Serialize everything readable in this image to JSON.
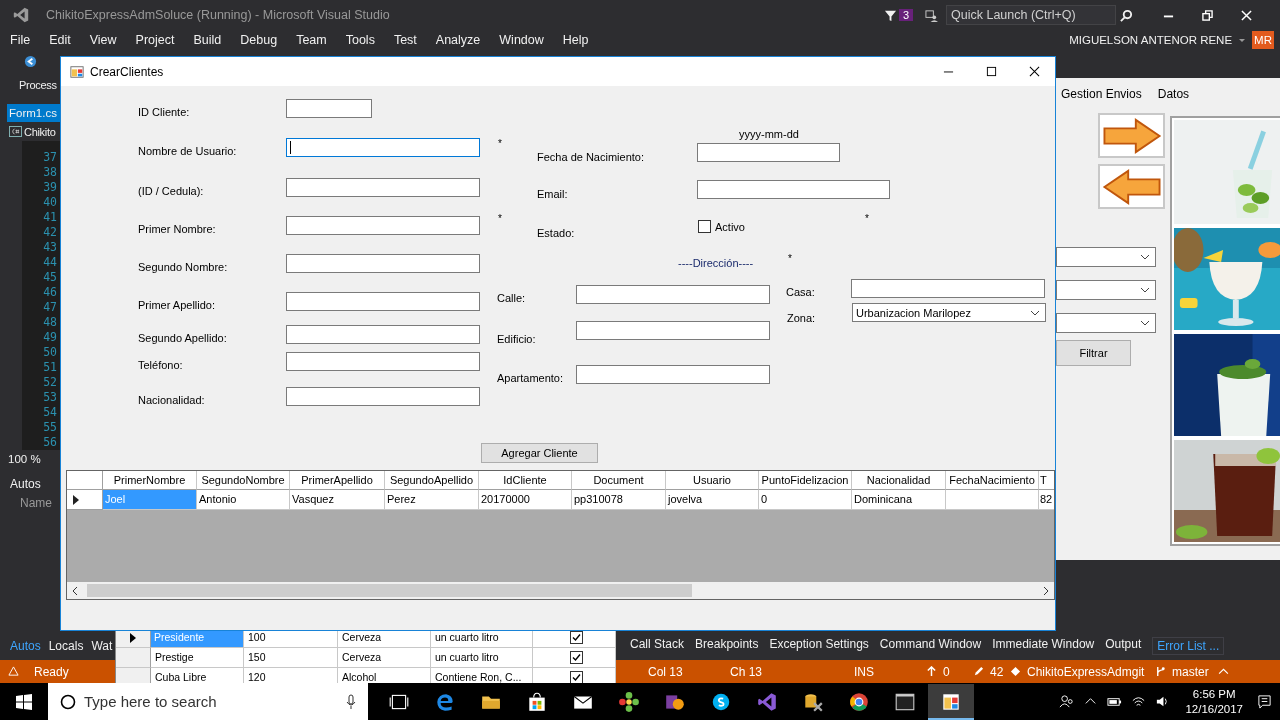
{
  "ide": {
    "title": "ChikitoExpressAdmSoluce (Running) - Microsoft Visual Studio",
    "notification_count": "3",
    "quick_launch": {
      "placeholder": "Quick Launch (Ctrl+Q)"
    },
    "menu": [
      "File",
      "Edit",
      "View",
      "Project",
      "Build",
      "Debug",
      "Team",
      "Tools",
      "Test",
      "Analyze",
      "Window",
      "Help"
    ],
    "user": "MIGUELSON ANTENOR RENE",
    "avatar": "MR",
    "left_panel": {
      "process_label": "Process",
      "tab": {
        "label": "Form1.cs",
        "selected": true
      },
      "file": "Chikito",
      "line_numbers": [
        "37",
        "38",
        "39",
        "40",
        "41",
        "42",
        "43",
        "44",
        "45",
        "46",
        "47",
        "48",
        "49",
        "50",
        "51",
        "52",
        "53",
        "54",
        "55",
        "56"
      ],
      "zoom": "100 %",
      "autos_title": "Autos",
      "autos_column": "Name",
      "bottom_tabs": [
        {
          "label": "Autos",
          "selected": true
        },
        {
          "label": "Locals",
          "selected": false
        },
        {
          "label": "Wat",
          "selected": false
        }
      ]
    },
    "tool_tabs": [
      {
        "label": "Call Stack",
        "selected": false
      },
      {
        "label": "Breakpoints",
        "selected": false
      },
      {
        "label": "Exception Settings",
        "selected": false
      },
      {
        "label": "Command Window",
        "selected": false
      },
      {
        "label": "Immediate Window",
        "selected": false
      },
      {
        "label": "Output",
        "selected": false
      },
      {
        "label": "Error List ...",
        "selected": true
      }
    ],
    "status_bar": {
      "state": "Ready",
      "col": "Col 13",
      "ch": "Ch 13",
      "mode": "INS",
      "pushes": "0",
      "changes": "42",
      "repo": "ChikitoExpressAdmgit",
      "branch": "master"
    }
  },
  "background_app": {
    "menu": [
      "Gestion Envios",
      "Datos"
    ],
    "filter_button": "Filtrar",
    "pictures": [
      {
        "kind": "picture"
      },
      {
        "kind": "picture"
      },
      {
        "kind": "picture"
      },
      {
        "kind": "picture"
      }
    ]
  },
  "product_grid": {
    "rows": [
      {
        "name": "Presidente",
        "price": "100",
        "type": "Cerveza",
        "description": "un cuarto litro",
        "checked": true,
        "selected": true
      },
      {
        "name": "Prestige",
        "price": "150",
        "type": "Cerveza",
        "description": "un cuarto litro",
        "checked": true,
        "selected": false
      },
      {
        "name": "Cuba Libre",
        "price": "120",
        "type": "Alcohol",
        "description": "Contiene Ron, C...",
        "checked": true,
        "selected": false
      }
    ]
  },
  "dialog": {
    "title": "CrearClientes",
    "personal_fields": [
      {
        "label": "ID Cliente:",
        "focused": false
      },
      {
        "label": "Nombre de Usuario:",
        "focused": true
      },
      {
        "label": "(ID / Cedula):",
        "focused": false
      },
      {
        "label": "Primer Nombre:",
        "focused": false
      },
      {
        "label": "Segundo Nombre:",
        "focused": false
      },
      {
        "label": "Primer Apellido:",
        "focused": false
      },
      {
        "label": "Segundo Apellido:",
        "focused": false
      },
      {
        "label": "Teléfono:",
        "focused": false
      },
      {
        "label": "Nacionalidad:",
        "focused": false
      }
    ],
    "date_format_hint": "yyyy-mm-dd",
    "contact_fields": [
      {
        "label": "Fecha de Nacimiento:"
      },
      {
        "label": "Email:"
      }
    ],
    "status": {
      "label": "Estado:",
      "checkbox_label": "Activo",
      "checked": false
    },
    "address_heading": "----Dirección----",
    "address_fields": [
      {
        "label": "Calle:",
        "kind": "text"
      },
      {
        "label": "Edificio:",
        "kind": "text"
      },
      {
        "label": "Apartamento:",
        "kind": "text"
      },
      {
        "label": "Casa:",
        "kind": "text"
      },
      {
        "label": "Zona:",
        "kind": "select",
        "value": "Urbanizacion Marilopez"
      }
    ],
    "required_marks": [
      "*",
      "*",
      "*",
      "*"
    ],
    "submit_button": "Agregar Cliente",
    "grid": {
      "columns": [
        "PrimerNombre",
        "SegundoNombre",
        "PrimerApellido",
        "SegundoApellido",
        "IdCliente",
        "Document",
        "Usuario",
        "PuntoFidelizacion",
        "Nacionalidad",
        "FechaNacimiento",
        "T"
      ],
      "rows": [
        {
          "cells": [
            {
              "text": "Joel",
              "selected": true
            },
            {
              "text": "Antonio",
              "selected": false
            },
            {
              "text": "Vasquez",
              "selected": false
            },
            {
              "text": "Perez",
              "selected": false
            },
            {
              "text": "20170000",
              "selected": false
            },
            {
              "text": "pp310078",
              "selected": false
            },
            {
              "text": "jovelva",
              "selected": false
            },
            {
              "text": "0",
              "selected": false
            },
            {
              "text": "Dominicana",
              "selected": false
            },
            {
              "selected": false
            },
            {
              "text": "82",
              "selected": false
            }
          ]
        }
      ]
    }
  },
  "taskbar": {
    "search": {
      "placeholder": "Type here to search"
    },
    "clock": {
      "time": "6:56 PM",
      "date": "12/16/2017"
    }
  }
}
